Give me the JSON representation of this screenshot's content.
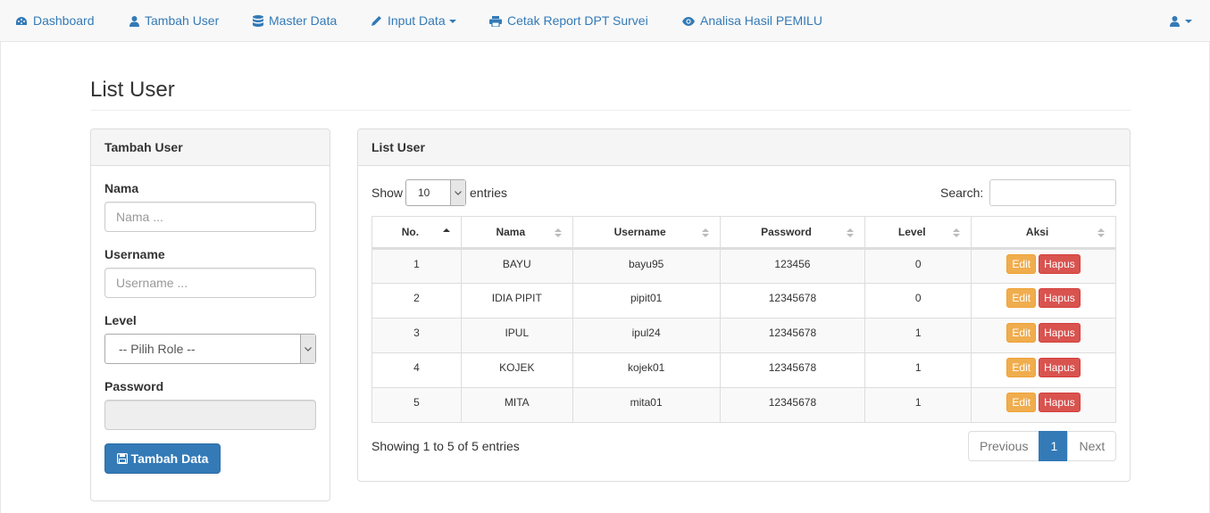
{
  "navbar": {
    "items": [
      {
        "label": "Dashboard",
        "icon": "dashboard-icon"
      },
      {
        "label": "Tambah User",
        "icon": "user-icon"
      },
      {
        "label": "Master Data",
        "icon": "database-icon"
      },
      {
        "label": "Input Data",
        "icon": "pencil-icon"
      },
      {
        "label": "Cetak Report DPT Survei",
        "icon": "print-icon"
      },
      {
        "label": "Analisa Hasil PEMILU",
        "icon": "eye-icon"
      }
    ],
    "user_menu_icon": "user-icon",
    "link_color": "#337ab7"
  },
  "page": {
    "title": "List User"
  },
  "form_panel": {
    "heading": "Tambah User",
    "nama_label": "Nama",
    "nama_placeholder": "Nama ...",
    "username_label": "Username",
    "username_placeholder": "Username ...",
    "level_label": "Level",
    "level_selected": "-- Pilih Role --",
    "password_label": "Password",
    "submit_label": "Tambah Data",
    "submit_icon": "save-icon",
    "primary_color": "#337ab7"
  },
  "list_panel": {
    "heading": "List User",
    "show_label": "Show",
    "entries_value": "10",
    "entries_label": "entries",
    "search_label": "Search:",
    "columns": [
      "No.",
      "Nama",
      "Username",
      "Password",
      "Level",
      "Aksi"
    ],
    "rows": [
      {
        "no": "1",
        "nama": "BAYU",
        "username": "bayu95",
        "password": "123456",
        "level": "0"
      },
      {
        "no": "2",
        "nama": "IDIA PIPIT",
        "username": "pipit01",
        "password": "12345678",
        "level": "0"
      },
      {
        "no": "3",
        "nama": "IPUL",
        "username": "ipul24",
        "password": "12345678",
        "level": "1"
      },
      {
        "no": "4",
        "nama": "KOJEK",
        "username": "kojek01",
        "password": "12345678",
        "level": "1"
      },
      {
        "no": "5",
        "nama": "MITA",
        "username": "mita01",
        "password": "12345678",
        "level": "1"
      }
    ],
    "edit_label": "Edit",
    "delete_label": "Hapus",
    "info": "Showing 1 to 5 of 5 entries",
    "pagination": {
      "previous": "Previous",
      "current": "1",
      "next": "Next"
    }
  }
}
